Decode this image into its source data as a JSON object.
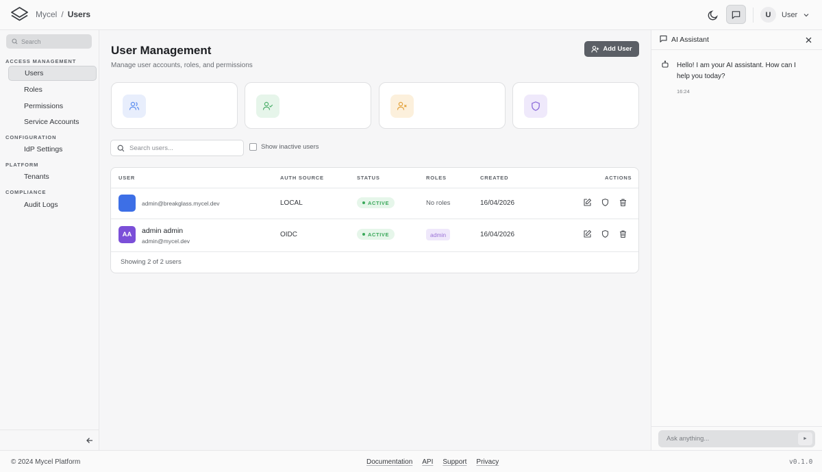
{
  "breadcrumb": {
    "app": "Mycel",
    "separator": "/",
    "current": "Users"
  },
  "topbar": {
    "user_initial": "U",
    "user_label": "User"
  },
  "sidebar": {
    "search_placeholder": "Search",
    "sections": [
      {
        "title": "ACCESS MANAGEMENT",
        "items": [
          "Users",
          "Roles",
          "Permissions",
          "Service Accounts"
        ]
      },
      {
        "title": "CONFIGURATION",
        "items": [
          "IdP Settings"
        ]
      },
      {
        "title": "PLATFORM",
        "items": [
          "Tenants"
        ]
      },
      {
        "title": "COMPLIANCE",
        "items": [
          "Audit Logs"
        ]
      }
    ],
    "active_item": "Users"
  },
  "main": {
    "title": "User Management",
    "subtitle": "Manage user accounts, roles, and permissions",
    "add_button": "Add User",
    "stat_cards": [
      {
        "icon": "users-icon",
        "color": "#5b8def",
        "bg": "#e8eefc"
      },
      {
        "icon": "user-check-icon",
        "color": "#4caf6a",
        "bg": "#e6f5ea"
      },
      {
        "icon": "user-x-icon",
        "color": "#e3a13a",
        "bg": "#fcf0dc"
      },
      {
        "icon": "shield-icon",
        "color": "#8b6bd9",
        "bg": "#efe9fb"
      }
    ],
    "search_placeholder": "Search users...",
    "inactive_toggle_label": "Show inactive users",
    "table": {
      "headers": [
        "USER",
        "AUTH SOURCE",
        "STATUS",
        "ROLES",
        "CREATED",
        "ACTIONS"
      ],
      "rows": [
        {
          "avatar_initials": "",
          "avatar_color": "#3d6fe6",
          "name": "",
          "email": "admin@breakglass.mycel.dev",
          "auth_source": "LOCAL",
          "status": "ACTIVE",
          "roles_text": "No roles",
          "role_badge": "",
          "created": "16/04/2026"
        },
        {
          "avatar_initials": "AA",
          "avatar_color": "#7b4fd8",
          "name": "admin admin",
          "email": "admin@mycel.dev",
          "auth_source": "OIDC",
          "status": "ACTIVE",
          "roles_text": "",
          "role_badge": "admin",
          "created": "16/04/2026"
        }
      ],
      "footer": "Showing 2 of 2 users"
    }
  },
  "ai_panel": {
    "title": "AI Assistant",
    "message": "Hello! I am your AI assistant. How can I help you today?",
    "message_time": "16:24",
    "input_placeholder": "Ask anything...",
    "send_label": "►"
  },
  "footer": {
    "copyright": "© 2024 Mycel Platform",
    "links": [
      "Documentation",
      "API",
      "Support",
      "Privacy"
    ],
    "version": "v0.1.0"
  }
}
